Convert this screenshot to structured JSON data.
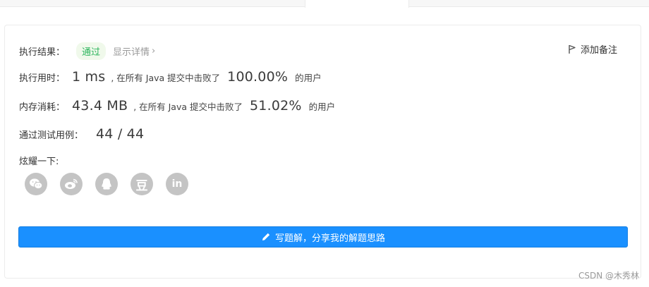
{
  "result": {
    "label": "执行结果：",
    "status": "通过",
    "detail_link": "显示详情",
    "note_button": "添加备注"
  },
  "runtime": {
    "label": "执行用时：",
    "value": "1 ms",
    "prefix": ", 在所有 Java 提交中击败了",
    "percent": "100.00%",
    "suffix": "的用户"
  },
  "memory": {
    "label": "内存消耗：",
    "value": "43.4 MB",
    "prefix": ", 在所有 Java 提交中击败了",
    "percent": "51.02%",
    "suffix": "的用户"
  },
  "tests": {
    "label": "通过测试用例：",
    "value": "44 / 44"
  },
  "share": {
    "label": "炫耀一下:",
    "icons": [
      "wechat-icon",
      "weibo-icon",
      "qq-icon",
      "douban-icon",
      "linkedin-icon"
    ],
    "douban_glyph": "豆",
    "linkedin_glyph": "in"
  },
  "write_solution": {
    "label": "写题解，分享我的解题思路"
  },
  "watermark": "CSDN @木秀林",
  "colors": {
    "accent": "#1a90ff",
    "success": "#2db55d",
    "success_bg": "#f0f9eb",
    "icon_gray": "#c4c4c4"
  }
}
